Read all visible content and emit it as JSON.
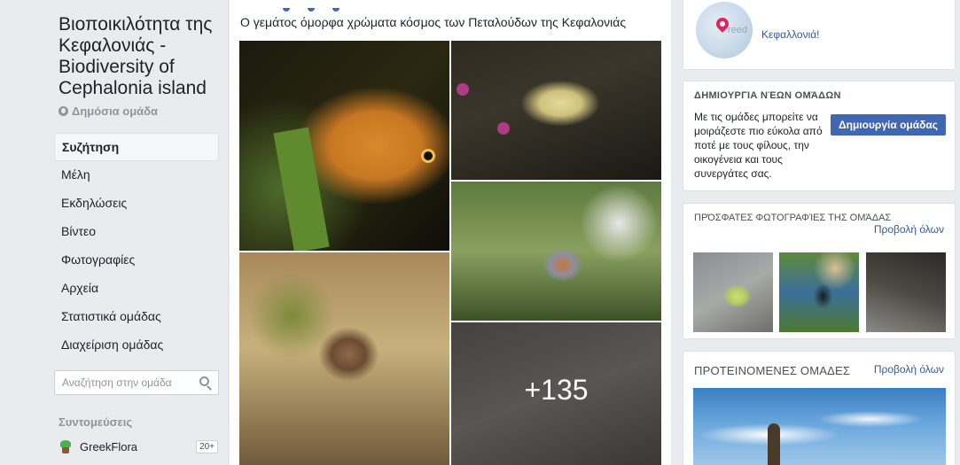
{
  "group": {
    "title": "Βιοποικιλότητα της Κεφαλονιάς - Biodiversity of Cephalonia island",
    "privacy": "Δημόσια ομάδα"
  },
  "nav": {
    "items": [
      {
        "label": "Συζήτηση",
        "active": true
      },
      {
        "label": "Μέλη"
      },
      {
        "label": "Εκδηλώσεις"
      },
      {
        "label": "Βίντεο"
      },
      {
        "label": "Φωτογραφίες"
      },
      {
        "label": "Αρχεία"
      },
      {
        "label": "Στατιστικά ομάδας"
      },
      {
        "label": "Διαχείριση ομάδας"
      }
    ]
  },
  "search": {
    "placeholder": "Αναζήτηση στην ομάδα"
  },
  "shortcuts": {
    "title": "Συντομεύσεις",
    "items": [
      {
        "label": "GreekFlora",
        "badge": "20+",
        "icon": "plant-icon"
      }
    ]
  },
  "post": {
    "text": "Ο γεμάτος όμορφα χρώματα κόσμος των Πεταλούδων της Κεφαλονιάς",
    "more_count": "+135"
  },
  "location": {
    "label": "Κεφαλλονιά!",
    "map_text": "reed"
  },
  "create_group": {
    "title": "ΔΗΜΙΟΥΡΓΙΑ ΝΈΩΝ ΟΜΆΔΩΝ",
    "text": "Με τις ομάδες μπορείτε να μοιράζεστε πιο εύκολα από ποτέ με τους φίλους, την οικογένεια και τους συνεργάτες σας.",
    "button": "Δημιουργία ομάδας"
  },
  "recent_photos": {
    "title": "ΠΡΌΣΦΑΤΕΣ ΦΩΤΟΓΡΑΦΊΕΣ ΤΗΣ ΟΜΆΔΑΣ",
    "see_all": "Προβολή όλων"
  },
  "suggested": {
    "title": "ΠΡΟΤΕΙΝΟΜΕΝΕΣ ΟΜΑΔΕΣ",
    "see_all": "Προβολή όλων"
  },
  "colors": {
    "accent": "#4267b2",
    "link": "#365899",
    "background": "#e9ebee"
  }
}
